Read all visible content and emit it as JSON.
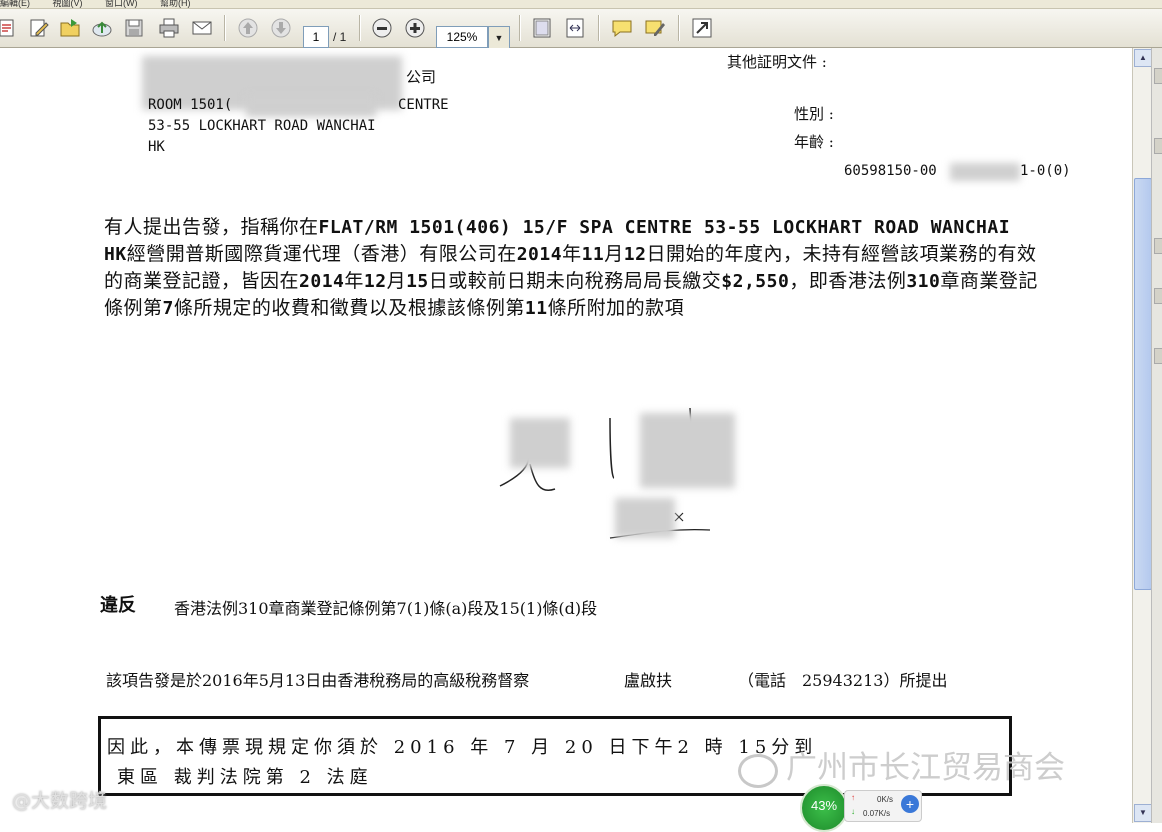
{
  "menubar": {
    "items": [
      "編輯(E)",
      "視圖(V)",
      "窗口(W)",
      "幫助(H)"
    ]
  },
  "toolbar": {
    "page_current": "1",
    "page_total": "/ 1",
    "zoom": "125%",
    "zoom_dropdown_icon": "▼",
    "icons": [
      "open-icon",
      "edit-icon",
      "folder-icon",
      "upload-icon",
      "save-icon",
      "print-icon",
      "email-icon",
      "prev-page-icon",
      "next-page-icon",
      "zoom-out-icon",
      "zoom-in-icon",
      "fit-page-icon",
      "fit-width-icon",
      "comment-icon",
      "highlight-icon",
      "fullscreen-icon"
    ]
  },
  "document": {
    "addr_company_end": "公司",
    "addr_line2_start": "ROOM 1501(",
    "addr_line2_end": "CENTRE",
    "addr_line3": "53-55 LOCKHART ROAD WANCHAI",
    "addr_line4": "HK",
    "other_docs_label": "其他証明文件 :",
    "gender_label": "性別 :",
    "age_label": "年齡 :",
    "ref_prefix": "60598150-00",
    "ref_suffix": "1-0(0)",
    "para": {
      "t1": "有人提出告發，指稱你在",
      "t2": "FLAT/RM 1501(406) 15/F SPA CENTRE 53-55 LOCKHART ROAD WANCHAI HK",
      "t3": "經營開普斯國際貨運代理（香港）有限公司在",
      "t4": "2014",
      "t5": "年",
      "t6": "11",
      "t7": "月",
      "t8": "12",
      "t9": "日開始的年度內，未持有經營該項業務的有效的商業登記證，皆因在",
      "t10": "2014",
      "t11": "年",
      "t12": "12",
      "t13": "月",
      "t14": "15",
      "t15": "日或較前日期未向稅務局局長繳交",
      "t16": "$2,550",
      "t17": "，即香港法例",
      "t18": "310",
      "t19": "章商業登記條例第",
      "t20": "7",
      "t21": "條所規定的收費和徵費以及根據該條例第",
      "t22": "11",
      "t23": "條所附加的款項"
    },
    "violation_label": "違反",
    "violation_text": "香港法例310章商業登記條例第7(1)條(a)段及15(1)條(d)段",
    "issued_text": "該項告發是於2016年5月13日由香港稅務局的高級稅務督察",
    "inspector": "盧啟扶",
    "phone_text": "（電話　25943213）所提出",
    "summons_line1": "因此，本傳票現規定你須於 2016 年  7 月  20 日下午2 時  15分到",
    "summons_line2": "東區      裁判法院第 2 法庭"
  },
  "watermark": {
    "text": "广州市长江贸易商会",
    "corner": "@大数跨境"
  },
  "net_widget": {
    "percent": "43%",
    "up_speed": "0K/s",
    "down_speed": "0.07K/s",
    "up_arrow": "↑",
    "down_arrow": "↓",
    "plus": "+"
  },
  "scrollbar": {
    "up": "▲",
    "down": "▼"
  }
}
